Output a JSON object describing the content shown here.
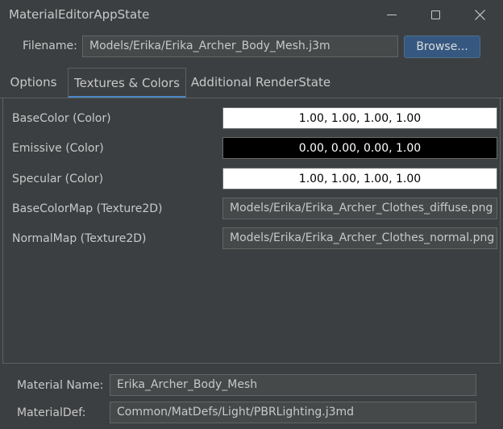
{
  "window": {
    "title": "MaterialEditorAppState",
    "icons": {
      "minimize": "minimize-icon",
      "maximize": "maximize-icon",
      "close": "close-icon"
    }
  },
  "file": {
    "label": "Filename:",
    "value": "Models/Erika/Erika_Archer_Body_Mesh.j3m",
    "browse_label": "Browse..."
  },
  "tabs": [
    {
      "label": "Options",
      "active": false
    },
    {
      "label": "Textures & Colors",
      "active": true
    },
    {
      "label": "Additional RenderState",
      "active": false
    }
  ],
  "params": [
    {
      "label": "BaseColor (Color)",
      "value": "1.00, 1.00, 1.00, 1.00",
      "swatch": "#ffffff"
    },
    {
      "label": "Emissive (Color)",
      "value": "0.00, 0.00, 0.00, 1.00",
      "swatch": "#000000"
    },
    {
      "label": "Specular (Color)",
      "value": "1.00, 1.00, 1.00, 1.00",
      "swatch": "#ffffff"
    },
    {
      "label": "BaseColorMap (Texture2D)",
      "value": "Models/Erika/Erika_Archer_Clothes_diffuse.png"
    },
    {
      "label": "NormalMap (Texture2D)",
      "value": "Models/Erika/Erika_Archer_Clothes_normal.png"
    }
  ],
  "material": {
    "name_label": "Material Name:",
    "name_value": "Erika_Archer_Body_Mesh",
    "def_label": "MaterialDef:",
    "def_value": "Common/MatDefs/Light/PBRLighting.j3md"
  },
  "colors": {
    "accent": "#4a88c7",
    "button": "#365880",
    "background": "#3c3f41"
  }
}
